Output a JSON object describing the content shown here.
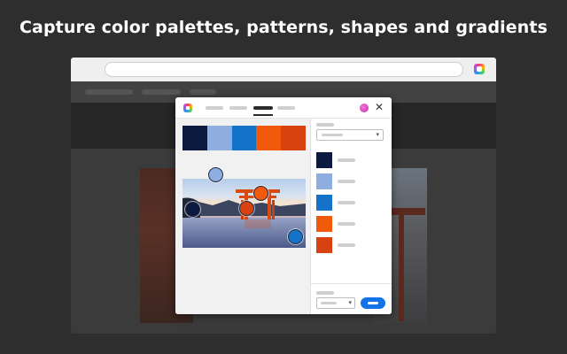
{
  "headline": "Capture color palettes, patterns, shapes and gradients",
  "browser": {
    "extension_icon": "creative-cloud-icon"
  },
  "panel": {
    "logo_icon": "adobe-color-logo-icon",
    "tabs_active_index": 2,
    "avatar_color": "#d23bb5",
    "close_glyph": "✕",
    "palette": [
      "#0d1a3f",
      "#8eaee0",
      "#1473c8",
      "#f05a0a",
      "#d84210"
    ],
    "dropdown_caret": "▾"
  }
}
